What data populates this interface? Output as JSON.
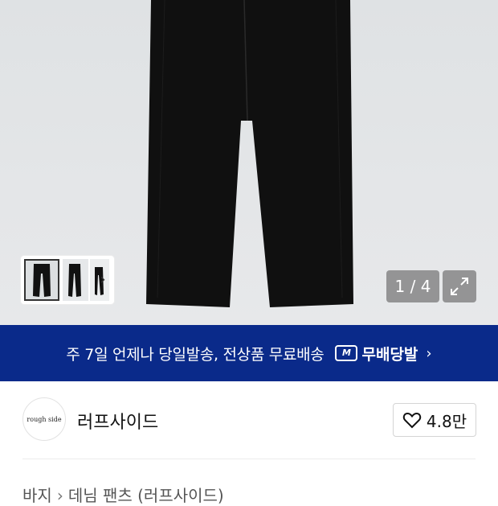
{
  "gallery": {
    "counter": "1 / 4"
  },
  "banner": {
    "text": "주 7일 언제나 당일발송, 전상품 무료배송",
    "badge_mark": "M",
    "badge_label": "무배당발"
  },
  "shop": {
    "logo_text": "rough side",
    "name": "러프사이드",
    "rating": "4.8만"
  },
  "breadcrumb": {
    "category": "바지",
    "subcategory": "데님 팬츠 (러프사이드)"
  },
  "colors": {
    "banner_bg": "#0a2a8a",
    "product": "#111111"
  }
}
